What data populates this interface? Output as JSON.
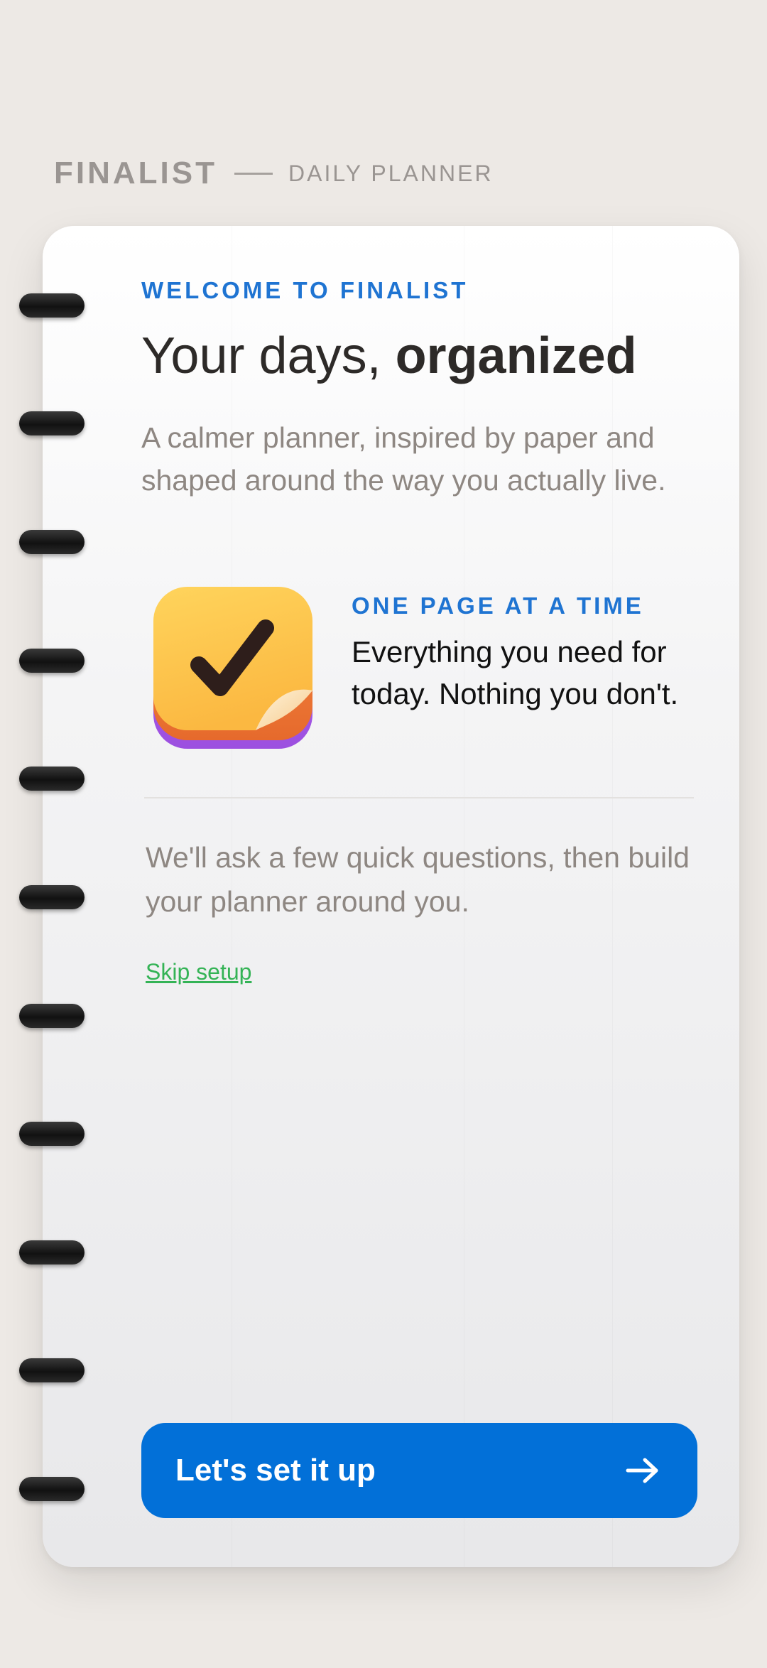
{
  "header": {
    "brand": "FINALIST",
    "subtitle": "DAILY PLANNER"
  },
  "welcome": {
    "eyebrow": "WELCOME TO FINALIST",
    "title_regular": "Your days, ",
    "title_bold": "organized",
    "subtitle": "A calmer planner, inspired by paper and shaped around the way you actually live."
  },
  "feature": {
    "icon": "checkmark-note-icon",
    "eyebrow": "ONE PAGE AT A TIME",
    "text": "Everything you need for today. Nothing you don't."
  },
  "note": "We'll ask a few quick questions, then build your planner around you.",
  "skip_label": "Skip setup",
  "cta": {
    "label": "Let's set it up",
    "icon": "arrow-right-icon"
  },
  "colors": {
    "accent_blue": "#0270D8",
    "eyebrow_blue": "#1F74D2",
    "skip_green": "#34B356",
    "background": "#EDE9E5"
  }
}
